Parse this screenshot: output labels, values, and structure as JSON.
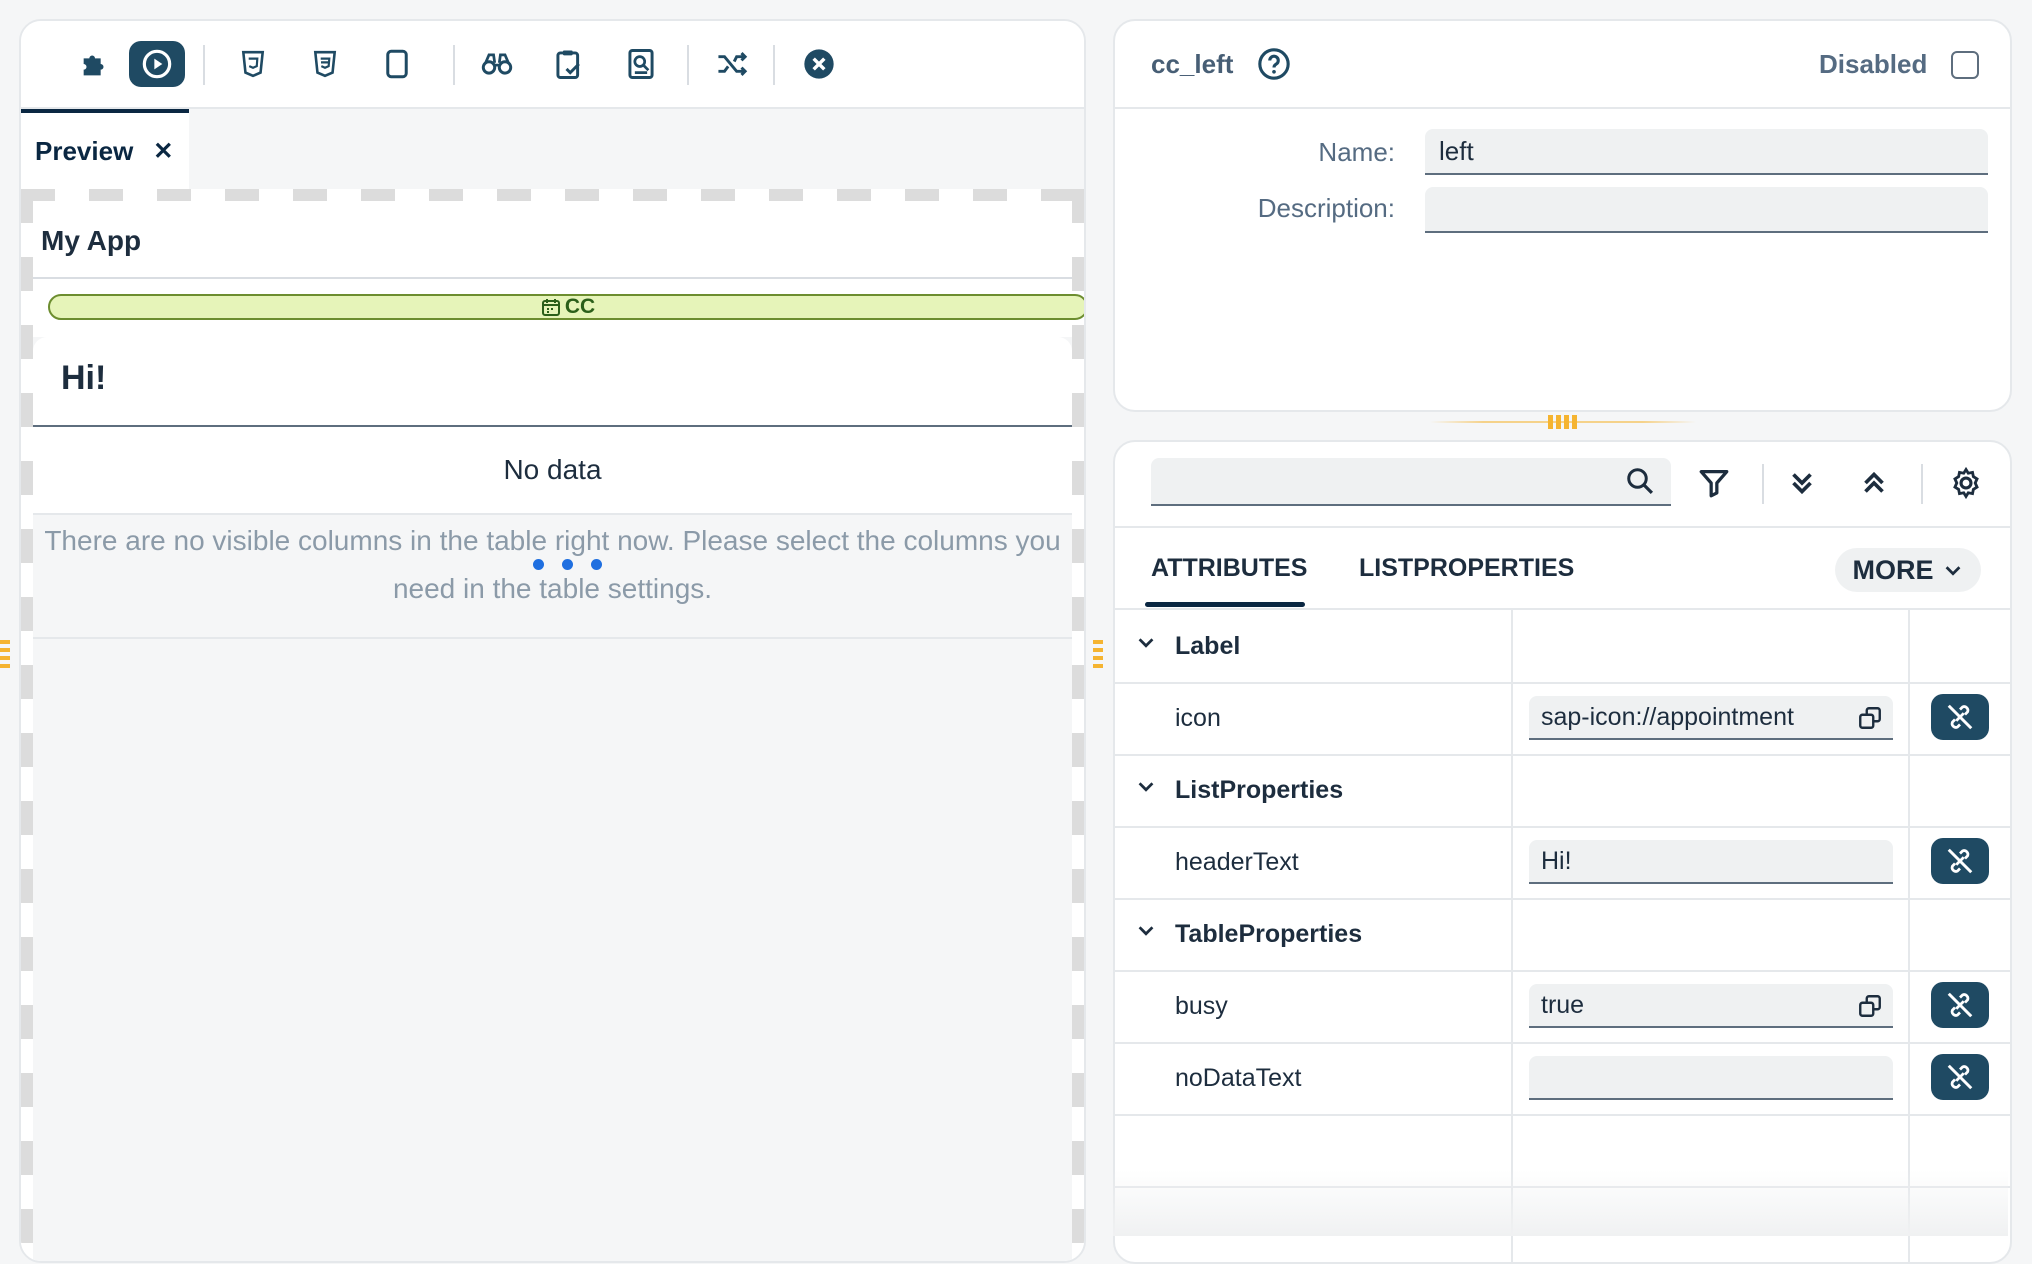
{
  "toolbar": {
    "icons": [
      "puzzle-icon",
      "play-icon",
      "html5-icon",
      "css3-icon",
      "device-icon",
      "binoculars-icon",
      "clipboard-check-icon",
      "document-search-icon",
      "shuffle-icon",
      "close-icon"
    ]
  },
  "preview_tab": {
    "label": "Preview",
    "close_glyph": "✕"
  },
  "app": {
    "title": "My App",
    "cc_label": "CC",
    "table_title": "Hi!",
    "no_data": "No data",
    "no_columns_msg": "There are no visible columns in the table right now. Please select the columns you need in the table settings."
  },
  "control_panel": {
    "title": "cc_left",
    "disabled_label": "Disabled",
    "disabled_checked": false,
    "name_label": "Name:",
    "name_value": "left",
    "description_label": "Description:",
    "description_value": ""
  },
  "properties_panel": {
    "search_placeholder": "",
    "tabs": {
      "attributes": "ATTRIBUTES",
      "listproperties": "LISTPROPERTIES",
      "more": "MORE"
    },
    "groups": {
      "label": {
        "name": "Label",
        "icon_prop": "icon",
        "icon_value": "sap-icon://appointment"
      },
      "list": {
        "name": "ListProperties",
        "header_prop": "headerText",
        "header_value": "Hi!"
      },
      "table": {
        "name": "TableProperties",
        "busy_prop": "busy",
        "busy_value": "true",
        "nodata_prop": "noDataText",
        "nodata_value": ""
      }
    }
  },
  "colors": {
    "accent": "#0a2742",
    "bind_button": "#1f4a63",
    "cc_bar": "#e6f4b9",
    "busy_dots": "#1f6fe0",
    "grip": "#f5b431"
  }
}
